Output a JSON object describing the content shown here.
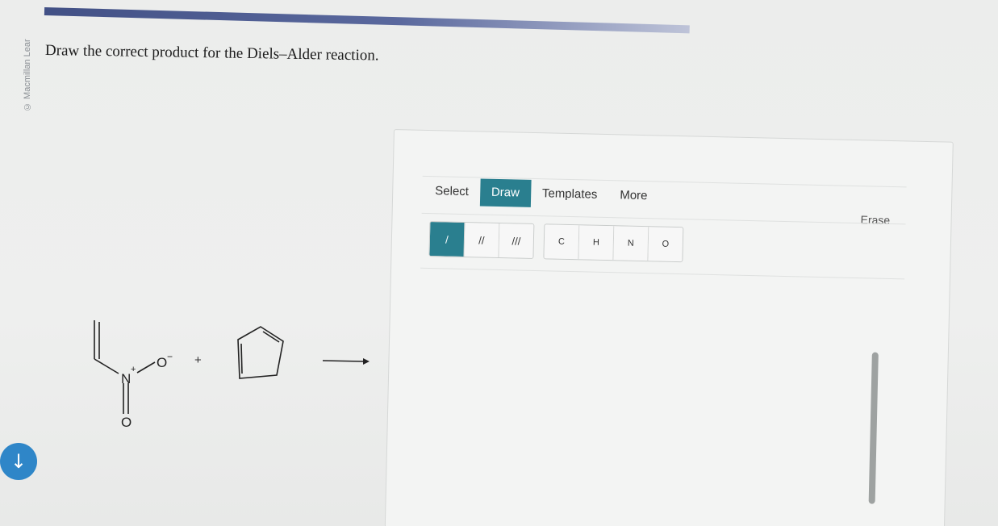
{
  "credit": "© Macmillan Lear",
  "question": "Draw the correct product for the Diels–Alder reaction.",
  "reaction": {
    "nitro_o_minus": "O",
    "nitro_o_minus_charge": "−",
    "nitro_n": "N",
    "nitro_n_charge": "+",
    "nitro_o_double": "O",
    "plus_sign": "+"
  },
  "editor": {
    "tabs": [
      "Select",
      "Draw",
      "Templates",
      "More"
    ],
    "active_tab": "Draw",
    "erase_label": "Erase",
    "bond_tools": [
      "/",
      "//",
      "///"
    ],
    "atom_tools": [
      "C",
      "H",
      "N",
      "O"
    ]
  },
  "icons": {
    "down_arrow": "↓"
  },
  "colors": {
    "accent": "#2a7f8f",
    "down_button": "#2f86c8",
    "top_bar": "#2f3f7a"
  }
}
